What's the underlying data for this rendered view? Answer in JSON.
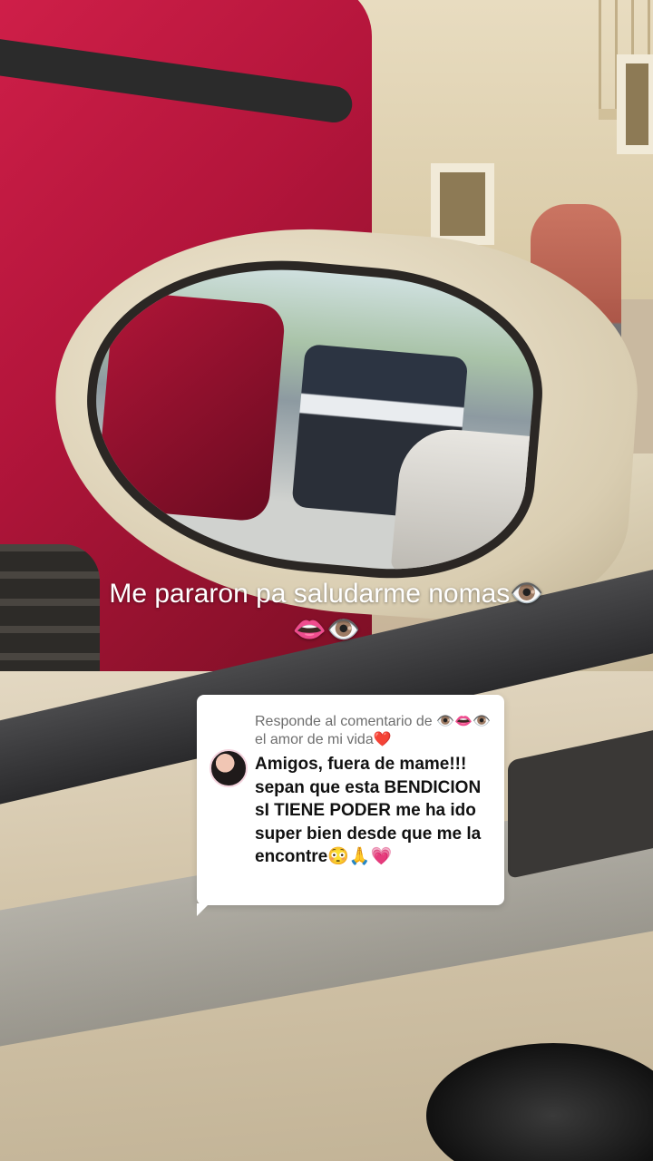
{
  "video": {
    "caption": "Me pararon pa saludarme nomas👁️👄👁️"
  },
  "comment_reply": {
    "header": "Responde al comentario de 👁️👄👁️ el amor de mi vida❤️",
    "body": "Amigos, fuera de mame!!! sepan que esta BENDICION sI TIENE PODER me ha ido super bien desde que me la encontre😳🙏💗"
  },
  "colors": {
    "card_background": "#ffffff",
    "header_text": "#6e6e6e",
    "body_text": "#111111",
    "caption_text": "#ffffff"
  }
}
